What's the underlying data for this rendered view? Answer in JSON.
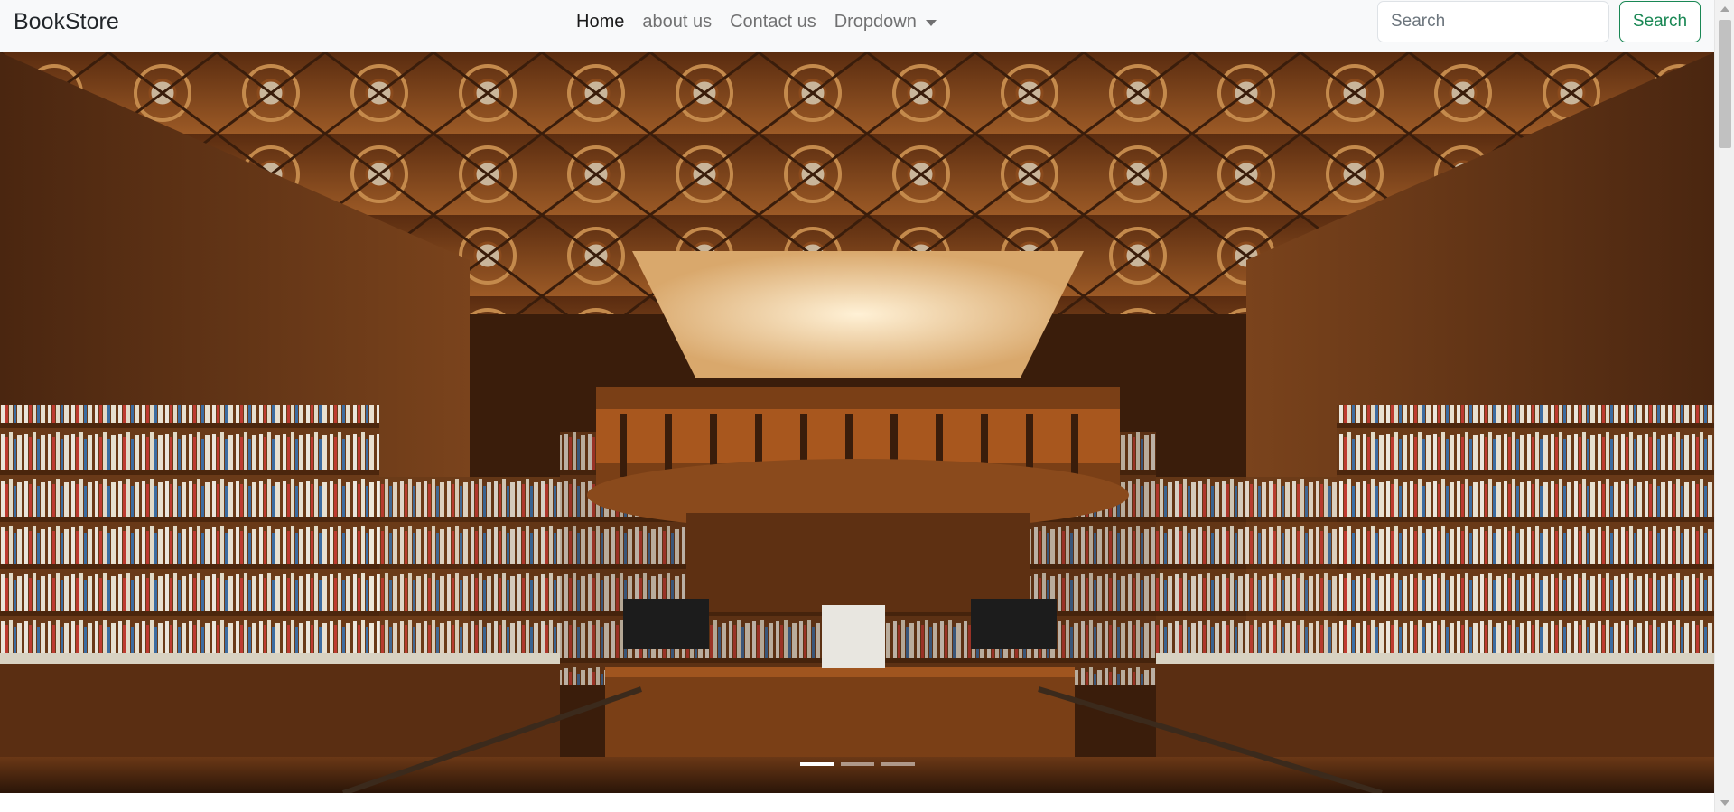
{
  "navbar": {
    "brand": "BookStore",
    "links": [
      {
        "label": "Home",
        "active": true
      },
      {
        "label": "about us",
        "active": false
      },
      {
        "label": "Contact us",
        "active": false
      },
      {
        "label": "Dropdown",
        "active": false,
        "has_caret": true
      }
    ],
    "search": {
      "placeholder": "Search",
      "value": "",
      "button_label": "Search"
    }
  },
  "carousel": {
    "image": "bookstore-interior-photo",
    "indicators": [
      {
        "active": true
      },
      {
        "active": false
      },
      {
        "active": false
      }
    ]
  },
  "colors": {
    "navbar_bg": "#f8f9fa",
    "search_button": "#198754",
    "wood_dark": "#3a1d0b",
    "wood_mid": "#8a4a1c"
  },
  "icons": {
    "dropdown": "chevron-down-icon",
    "scroll_up": "arrow-up-icon",
    "scroll_down": "arrow-down-icon"
  }
}
